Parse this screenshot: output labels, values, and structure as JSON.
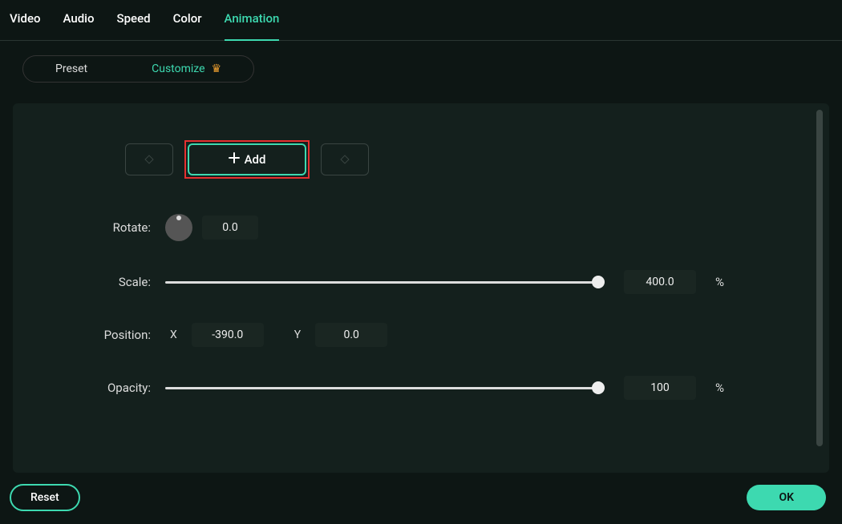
{
  "tabs": {
    "video": "Video",
    "audio": "Audio",
    "speed": "Speed",
    "color": "Color",
    "animation": "Animation"
  },
  "subtabs": {
    "preset": "Preset",
    "customize": "Customize"
  },
  "keyframe": {
    "add": "Add"
  },
  "props": {
    "rotate_label": "Rotate:",
    "rotate_value": "0.0",
    "scale_label": "Scale:",
    "scale_value": "400.0",
    "scale_unit": "%",
    "scale_pct": 100,
    "position_label": "Position:",
    "x_label": "X",
    "x_value": "-390.0",
    "y_label": "Y",
    "y_value": "0.0",
    "opacity_label": "Opacity:",
    "opacity_value": "100",
    "opacity_unit": "%",
    "opacity_pct": 100
  },
  "footer": {
    "reset": "Reset",
    "ok": "OK"
  },
  "colors": {
    "accent": "#3dd9b0",
    "highlight": "#e53030",
    "crown": "#f0a030"
  }
}
